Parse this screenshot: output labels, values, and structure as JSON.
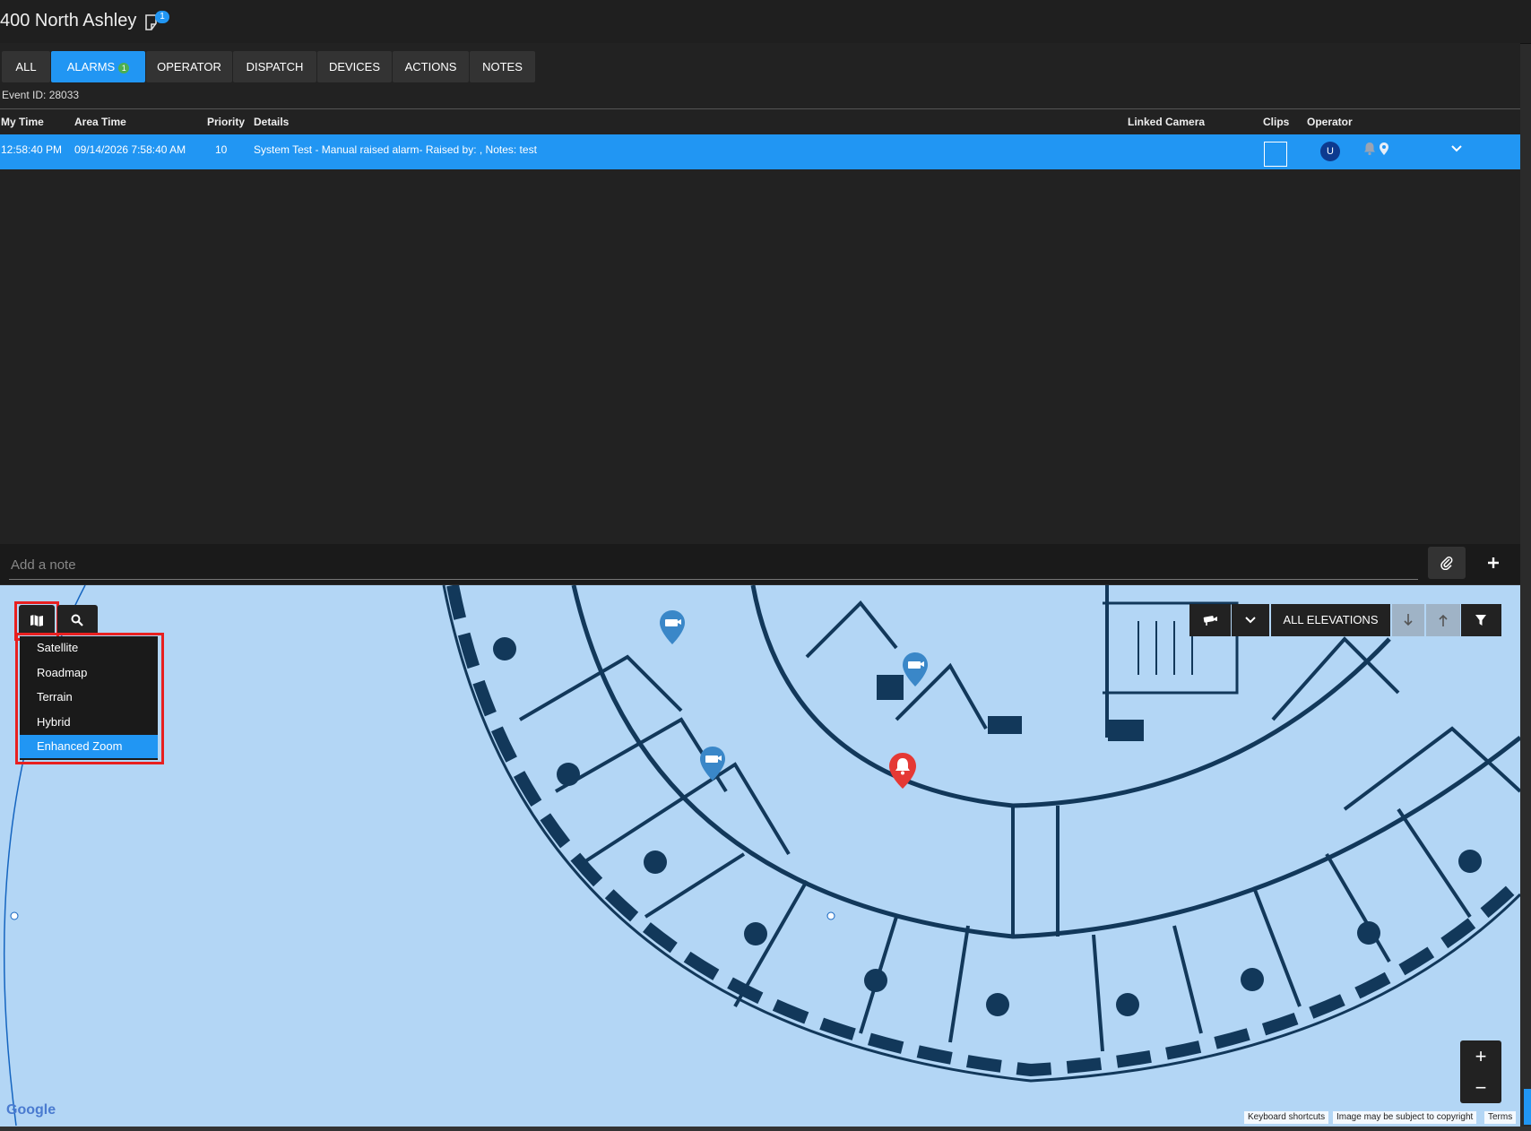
{
  "header": {
    "title": "400 North Ashley",
    "badge": "1"
  },
  "tabs": [
    {
      "label": "ALL"
    },
    {
      "label": "ALARMS",
      "badge": "1"
    },
    {
      "label": "OPERATOR"
    },
    {
      "label": "DISPATCH"
    },
    {
      "label": "DEVICES"
    },
    {
      "label": "ACTIONS"
    },
    {
      "label": "NOTES"
    }
  ],
  "event": {
    "id_text": "Event ID: 28033"
  },
  "table": {
    "headers": {
      "my_time": "My Time",
      "area_time": "Area Time",
      "priority": "Priority",
      "details": "Details",
      "linked_camera": "Linked Camera",
      "clips": "Clips",
      "operator": "Operator"
    },
    "rows": [
      {
        "my_time": "12:58:40 PM",
        "area_time": "09/14/2026 7:58:40 AM",
        "priority": "10",
        "details": "System Test - Manual raised alarm- Raised by: , Notes: test",
        "operator_initial": "U"
      }
    ]
  },
  "notes": {
    "placeholder": "Add a note"
  },
  "map": {
    "type_menu": [
      {
        "label": "Satellite"
      },
      {
        "label": "Roadmap"
      },
      {
        "label": "Terrain"
      },
      {
        "label": "Hybrid"
      },
      {
        "label": "Enhanced Zoom",
        "selected": true
      }
    ],
    "elevation_label": "ALL ELEVATIONS",
    "zoom_in": "+",
    "zoom_out": "−",
    "attribution": {
      "keyboard": "Keyboard shortcuts",
      "copyright": "Image may be subject to copyright",
      "terms": "Terms"
    },
    "logo": "Google"
  },
  "colors": {
    "accent": "#2196f3",
    "alarm": "#e53935",
    "camera": "#3a87c8",
    "highlight": "#e82020",
    "map_bg": "#b3d6f5"
  }
}
